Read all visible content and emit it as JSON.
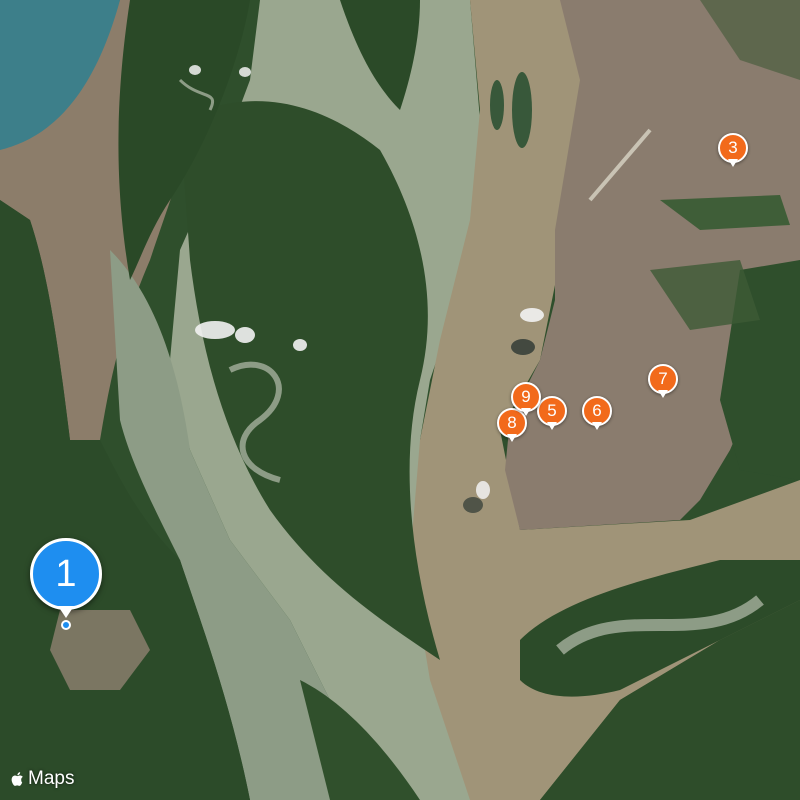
{
  "map": {
    "type": "satellite",
    "attribution": {
      "logo_icon": "apple-logo-icon",
      "text": "Maps"
    },
    "colors": {
      "water_murky": "#8c7d6a",
      "water_green": "#9aa78f",
      "forest": "#2f4f2c",
      "urban": "#8a7c6e",
      "ocean": "#3d7f8a",
      "pin_orange": "#f26a1b",
      "pin_blue": "#1e8ef0"
    },
    "markers": [
      {
        "id": "1",
        "label": "1",
        "style": "selected"
      },
      {
        "id": "3",
        "label": "3",
        "style": "default"
      },
      {
        "id": "5",
        "label": "5",
        "style": "default"
      },
      {
        "id": "6",
        "label": "6",
        "style": "default"
      },
      {
        "id": "7",
        "label": "7",
        "style": "default"
      },
      {
        "id": "8",
        "label": "8",
        "style": "default"
      },
      {
        "id": "9",
        "label": "9",
        "style": "default"
      }
    ]
  }
}
